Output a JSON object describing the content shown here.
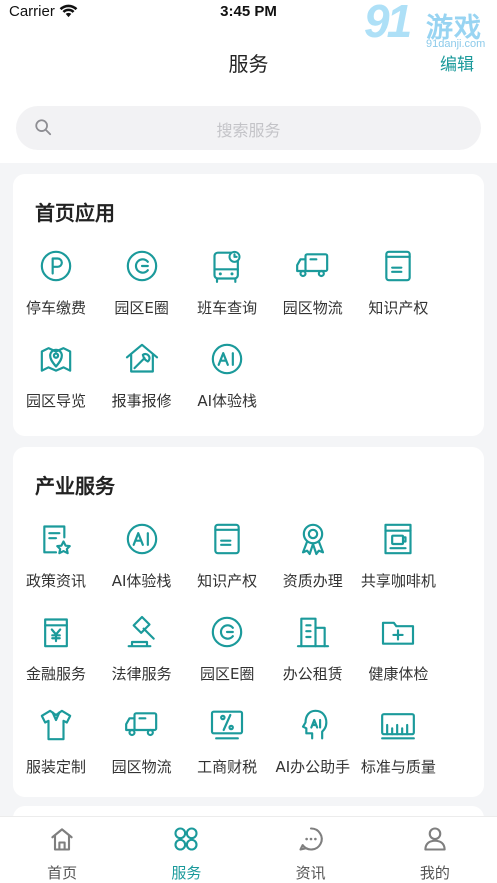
{
  "status_bar": {
    "carrier": "Carrier",
    "time": "3:45 PM"
  },
  "watermark": {
    "brand": "91",
    "game_text": "游戏",
    "url": "91danji.com"
  },
  "header": {
    "title": "服务",
    "edit_label": "编辑"
  },
  "search": {
    "placeholder": "搜索服务"
  },
  "colors": {
    "accent": "#1b9a9b",
    "background": "#f4f5f7",
    "card": "#ffffff"
  },
  "sections": [
    {
      "title": "首页应用",
      "items": [
        {
          "label": "停车缴费",
          "icon": "parking-icon"
        },
        {
          "label": "园区E圈",
          "icon": "e-circle-icon"
        },
        {
          "label": "班车查询",
          "icon": "shuttle-bus-icon"
        },
        {
          "label": "园区物流",
          "icon": "truck-icon"
        },
        {
          "label": "知识产权",
          "icon": "book-icon"
        },
        {
          "label": "园区导览",
          "icon": "map-pin-icon"
        },
        {
          "label": "报事报修",
          "icon": "repair-house-icon"
        },
        {
          "label": "AI体验栈",
          "icon": "ai-icon"
        }
      ]
    },
    {
      "title": "产业服务",
      "items": [
        {
          "label": "政策资讯",
          "icon": "policy-doc-icon"
        },
        {
          "label": "AI体验栈",
          "icon": "ai-icon"
        },
        {
          "label": "知识产权",
          "icon": "book-icon"
        },
        {
          "label": "资质办理",
          "icon": "award-ribbon-icon"
        },
        {
          "label": "共享咖啡机",
          "icon": "coffee-machine-icon"
        },
        {
          "label": "金融服务",
          "icon": "finance-yen-icon"
        },
        {
          "label": "法律服务",
          "icon": "gavel-icon"
        },
        {
          "label": "园区E圈",
          "icon": "e-circle-icon"
        },
        {
          "label": "办公租赁",
          "icon": "office-building-icon"
        },
        {
          "label": "健康体检",
          "icon": "health-folder-icon"
        },
        {
          "label": "服装定制",
          "icon": "shirt-icon"
        },
        {
          "label": "园区物流",
          "icon": "truck-icon"
        },
        {
          "label": "工商财税",
          "icon": "tax-percent-icon"
        },
        {
          "label": "AI办公助手",
          "icon": "ai-head-icon"
        },
        {
          "label": "标准与质量",
          "icon": "ruler-icon"
        }
      ]
    }
  ],
  "tabbar": {
    "active": "服务",
    "tabs": [
      {
        "label": "首页",
        "icon": "home-icon"
      },
      {
        "label": "服务",
        "icon": "clover-icon"
      },
      {
        "label": "资讯",
        "icon": "chat-bubble-icon"
      },
      {
        "label": "我的",
        "icon": "person-icon"
      }
    ]
  }
}
